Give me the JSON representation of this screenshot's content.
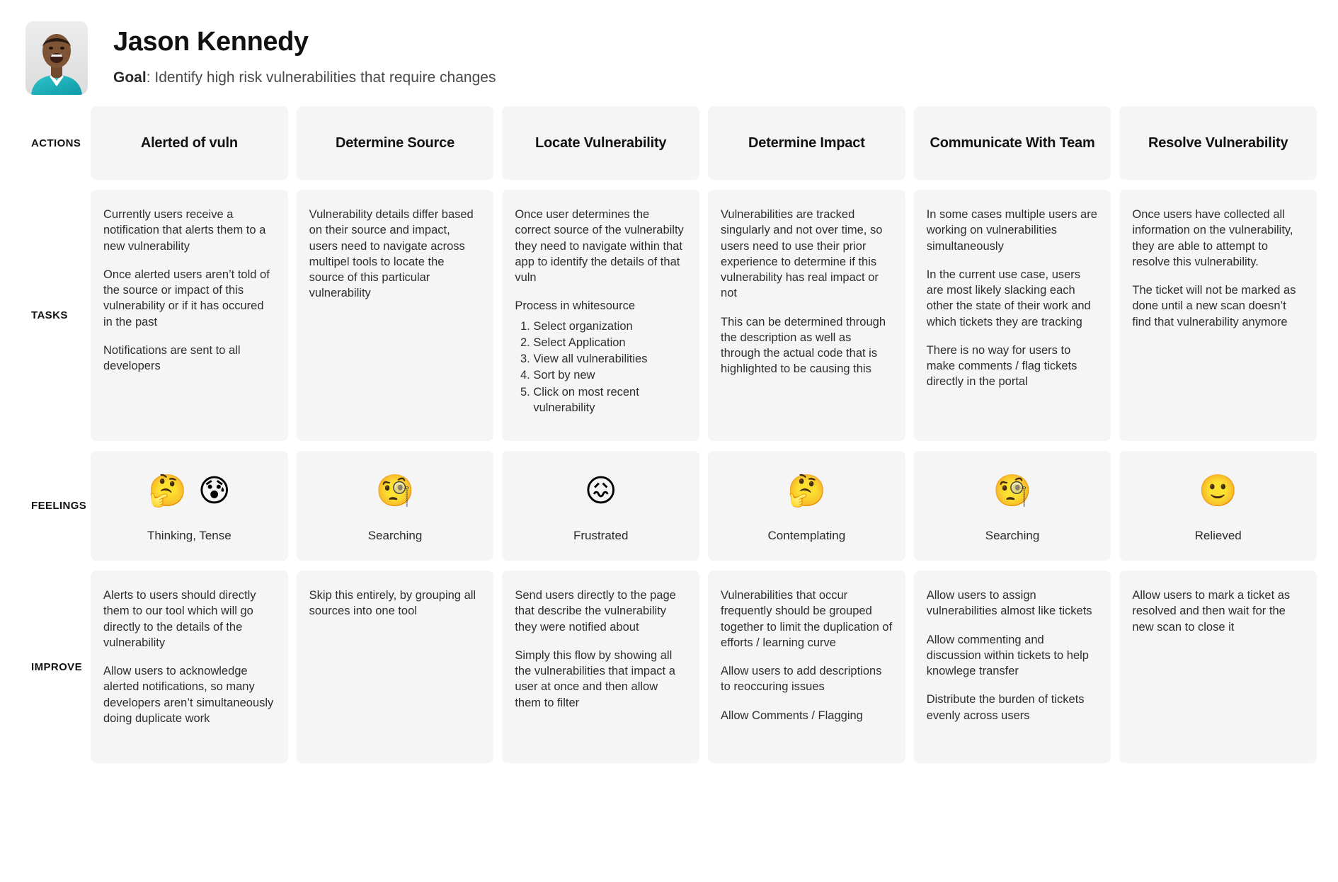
{
  "persona": {
    "name": "Jason Kennedy",
    "goal_label": "Goal",
    "goal_text": ": Identify high risk vulnerabilities that require changes",
    "avatar_alt": "persona-photo"
  },
  "row_labels": {
    "actions": "ACTIONS",
    "tasks": "TASKS",
    "feelings": "FEELINGS",
    "improve": "IMPROVE"
  },
  "columns": [
    {
      "action": "Alerted of vuln",
      "tasks": [
        "Currently users receive a notification that alerts them to a new vulnerability",
        "Once alerted users aren’t told of the source or impact of this vulnerability or if it has occured in the past",
        "Notifications are sent to all developers"
      ],
      "task_list": [],
      "feeling": {
        "emojis": [
          "🤔",
          "😰"
        ],
        "emoji_names": [
          "thinking-face-emoji",
          "anxious-face-with-sweat-emoji"
        ],
        "label": "Thinking, Tense"
      },
      "improve": [
        "Alerts to users should directly them to our tool which will go directly to the details of the vulnerability",
        "Allow users to acknowledge alerted notifications, so many developers aren’t simultaneously doing duplicate work"
      ]
    },
    {
      "action": "Determine Source",
      "tasks": [
        "Vulnerability details differ based on their source and impact, users need to navigate across multipel tools to locate the source of this particular vulnerability"
      ],
      "task_list": [],
      "feeling": {
        "emojis": [
          "🧐"
        ],
        "emoji_names": [
          "face-with-monocle-emoji"
        ],
        "label": "Searching"
      },
      "improve": [
        "Skip this entirely, by grouping all sources into one tool"
      ]
    },
    {
      "action": "Locate Vulnerability",
      "tasks": [
        "Once user determines the correct source of the vulnerabilty they need to navigate within that app to identify the details of that vuln",
        "Process in whitesource"
      ],
      "task_list": [
        "Select organization",
        "Select Application",
        "View all vulnerabilities",
        "Sort by new",
        "Click on most recent vulnerability"
      ],
      "feeling": {
        "emojis": [
          "😖"
        ],
        "emoji_names": [
          "confounded-face-emoji"
        ],
        "label": "Frustrated"
      },
      "improve": [
        "Send users directly to the page that describe the vulnerability they were notified about",
        "Simply this flow by showing all the vulnerabilities that impact a user at once and then allow them to filter"
      ]
    },
    {
      "action": "Determine Impact",
      "tasks": [
        "Vulnerabilities are tracked singularly and not over time, so users need to use their prior experience to determine if this vulnerability has real impact or not",
        "This can be determined through the description as well as through the actual code that is highlighted to be causing this"
      ],
      "task_list": [],
      "feeling": {
        "emojis": [
          "🤔"
        ],
        "emoji_names": [
          "thinking-face-emoji"
        ],
        "label": "Contemplating"
      },
      "improve": [
        "Vulnerabilities that occur frequently should be grouped together to limit the duplication of efforts / learning curve",
        "Allow users to add descriptions to reoccuring issues",
        "Allow Comments / Flagging"
      ]
    },
    {
      "action": "Communicate With Team",
      "tasks": [
        "In some cases multiple users are working on vulnerabilities simultaneously",
        "In the current use case, users are most likely slacking each other the state of their work and which tickets they are tracking",
        "There is no way for users to make comments / flag tickets directly in the portal"
      ],
      "task_list": [],
      "feeling": {
        "emojis": [
          "🧐"
        ],
        "emoji_names": [
          "face-with-monocle-emoji"
        ],
        "label": "Searching"
      },
      "improve": [
        "Allow users to assign vulnerabilities almost like tickets",
        "Allow commenting and discussion within tickets to help knowlege transfer",
        "Distribute the burden of tickets evenly across users"
      ]
    },
    {
      "action": "Resolve Vulnerability",
      "tasks": [
        "Once users have collected all information on the vulnerability, they are able to attempt to resolve this vulnerability.",
        "The ticket will not be marked as done until a new scan doesn’t find that vulnerability anymore"
      ],
      "task_list": [],
      "feeling": {
        "emojis": [
          "🙂"
        ],
        "emoji_names": [
          "slightly-smiling-face-emoji"
        ],
        "label": "Relieved"
      },
      "improve": [
        "Allow users to mark a ticket as resolved and then wait for the new scan to close it"
      ]
    }
  ],
  "colors": {
    "cell_background": "#f5f5f5",
    "page_background": "#ffffff",
    "text_primary": "#111111",
    "text_body": "#2e2e2e"
  }
}
